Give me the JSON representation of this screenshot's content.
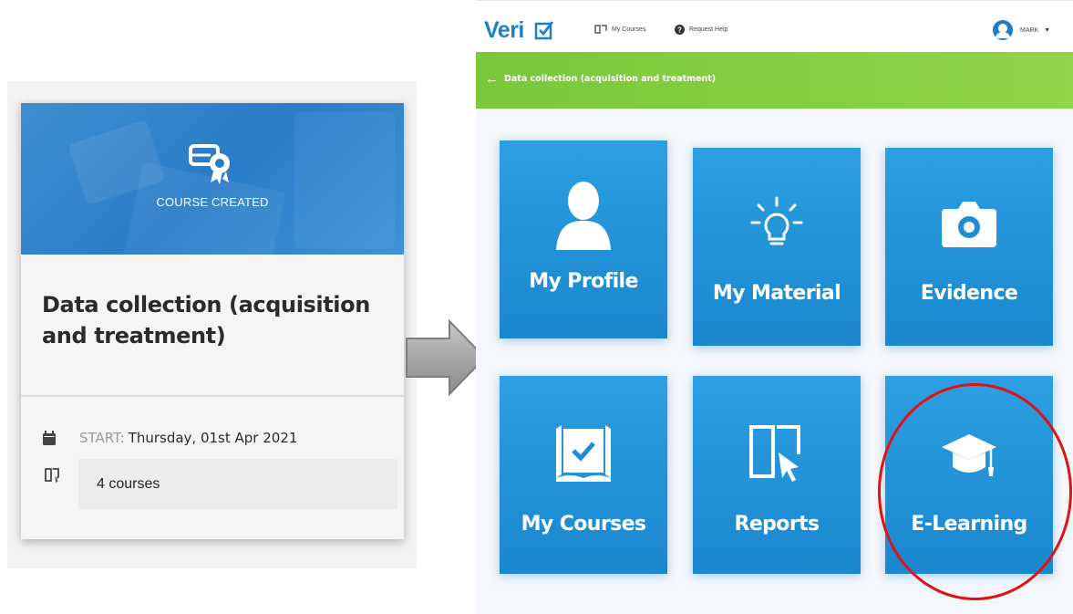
{
  "course_card": {
    "hero_caption": "COURSE CREATED",
    "hero_icon": "certificate-icon",
    "title": "Data collection (acquisition and treatment)",
    "start_label": "START:",
    "start_value": "Thursday, 01st Apr 2021",
    "courses_count": "4 courses",
    "calendar_icon": "calendar-icon",
    "courses_icon": "book-icon"
  },
  "arrow": {
    "icon": "arrow-right-icon",
    "color": "#9e9e9e"
  },
  "app": {
    "logo": "Veri",
    "topnav": {
      "my_courses": "My Courses",
      "request_help": "Request Help"
    },
    "user": {
      "name": "MARK"
    },
    "breadcrumb": {
      "back_text": "Data collection (acquisition and treatment)"
    },
    "tiles": [
      {
        "label": "My Profile",
        "icon": "user-icon"
      },
      {
        "label": "My Material",
        "icon": "lightbulb-icon"
      },
      {
        "label": "Evidence",
        "icon": "camera-icon"
      },
      {
        "label": "My Courses",
        "icon": "book-check-icon"
      },
      {
        "label": "Reports",
        "icon": "book-cursor-icon"
      },
      {
        "label": "E-Learning",
        "icon": "graduation-cap-icon"
      }
    ]
  },
  "colors": {
    "brand_blue": "#1e7fc9",
    "tile_blue": "#2d9fe2",
    "green_bar": "#86d040",
    "highlight_red": "#e31212"
  }
}
